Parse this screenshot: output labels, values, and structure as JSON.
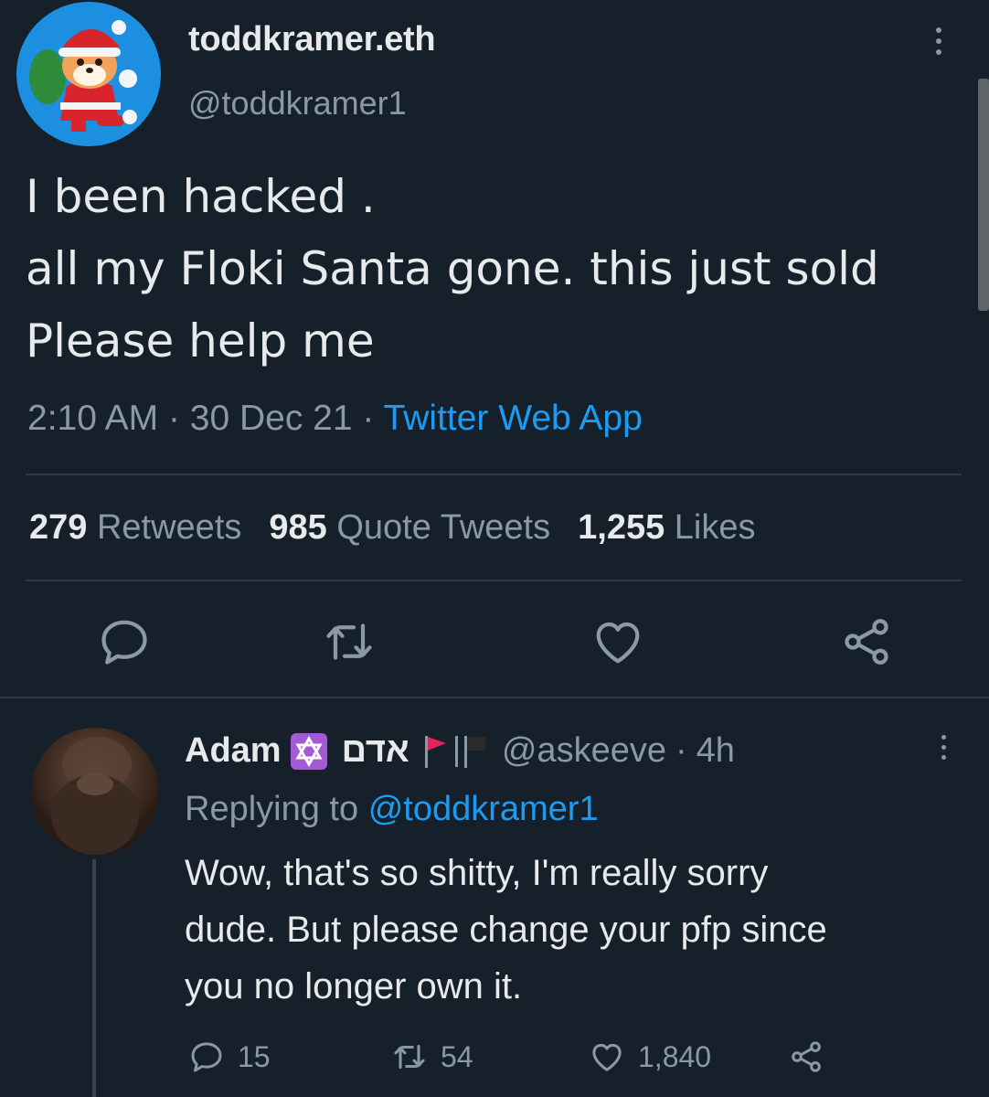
{
  "main_tweet": {
    "display_name": "toddkramer.eth",
    "handle": "@toddkramer1",
    "text_lines": [
      "I been hacked .",
      "all my Floki Santa gone. this just sold",
      "Please help me"
    ],
    "time": "2:10 AM",
    "date": "30 Dec 21",
    "separator": "·",
    "source": "Twitter Web App",
    "stats": {
      "retweets_count": "279",
      "retweets_label": "Retweets",
      "quotes_count": "985",
      "quotes_label": "Quote Tweets",
      "likes_count": "1,255",
      "likes_label": "Likes"
    },
    "actions": [
      "reply-icon",
      "retweet-icon",
      "like-icon",
      "share-icon"
    ]
  },
  "reply": {
    "display_name": "Adam",
    "hebrew_name": "אדם",
    "handle": "@askeeve",
    "separator": "·",
    "time": "4h",
    "replying_prefix": "Replying to",
    "replying_to": "@toddkramer1",
    "text_lines": [
      "Wow, that's so shitty, I'm really sorry",
      "dude. But please change your pfp since",
      "you no longer own it."
    ],
    "counts": {
      "replies": "15",
      "retweets": "54",
      "likes": "1,840"
    }
  },
  "colors": {
    "background": "#15202b",
    "text_primary": "#e7e9ea",
    "text_secondary": "#8b98a5",
    "link": "#1d9bf0",
    "divider": "#2f3a45",
    "badge_purple": "#a45ad4",
    "flag_red": "#e0245e"
  }
}
